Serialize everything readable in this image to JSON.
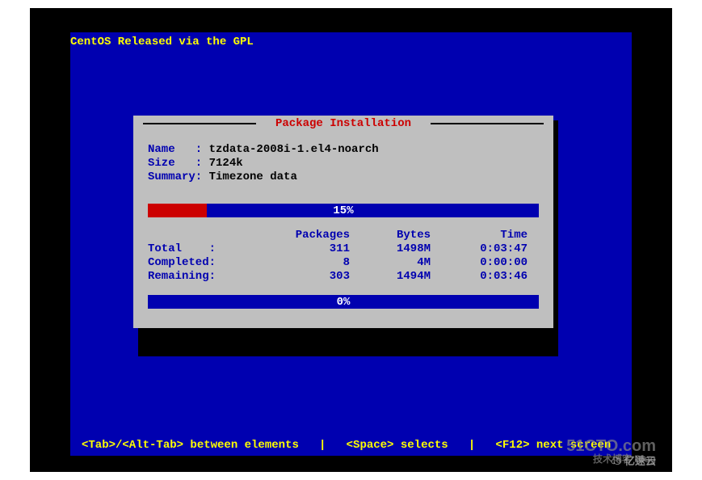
{
  "header": "CentOS Released via the GPL",
  "dialog": {
    "title": "Package Installation",
    "package": {
      "name_label": "Name   : ",
      "name": "tzdata-2008i-1.el4-noarch",
      "size_label": "Size   : ",
      "size": "7124k",
      "summary_label": "Summary: ",
      "summary": "Timezone data"
    },
    "progress1": {
      "percent": 15,
      "text": "15%"
    },
    "stats": {
      "headers": {
        "label": "",
        "packages": "Packages",
        "bytes": "Bytes",
        "time": "Time"
      },
      "total": {
        "label": "Total    :",
        "packages": "311",
        "bytes": "1498M",
        "time": "0:03:47"
      },
      "completed": {
        "label": "Completed:",
        "packages": "8",
        "bytes": "4M",
        "time": "0:00:00"
      },
      "remaining": {
        "label": "Remaining:",
        "packages": "303",
        "bytes": "1494M",
        "time": "0:03:46"
      }
    },
    "progress2": {
      "percent": 0,
      "text": "0%"
    }
  },
  "footer": "<Tab>/<Alt-Tab> between elements   |   <Space> selects   |   <F12> next screen",
  "watermark": {
    "main": "51CTO.com",
    "sub1": "技术博客 Blog",
    "sub2": "☁ 亿速云"
  }
}
